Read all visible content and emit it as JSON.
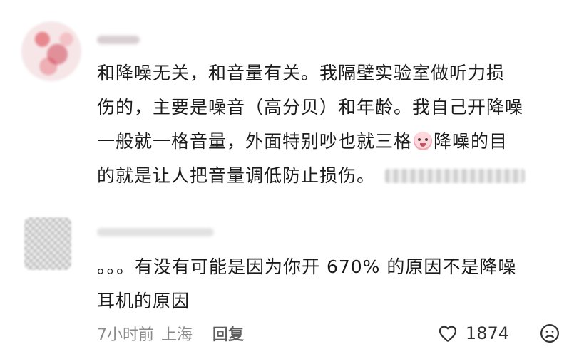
{
  "comments": [
    {
      "text_lines": [
        "和降噪无关，和音量有关。我隔壁实验室做听力损",
        "伤的，主要是噪音（高分贝）和年龄。我自己开降噪",
        "一般就一格音量，外面特别吵也就三格",
        "降噪的目",
        "的就是让人把音量调低防止损伤。"
      ]
    },
    {
      "text_lines": [
        "。。。有没有可能是因为你开 670% 的原因不是降噪",
        "耳机的原因"
      ],
      "meta": {
        "time": "7小时前",
        "location": "上海",
        "reply_label": "回复",
        "like_count": "1874",
        "like_icon": "heart-outline-icon",
        "dislike_icon": "sad-face-icon"
      }
    }
  ]
}
